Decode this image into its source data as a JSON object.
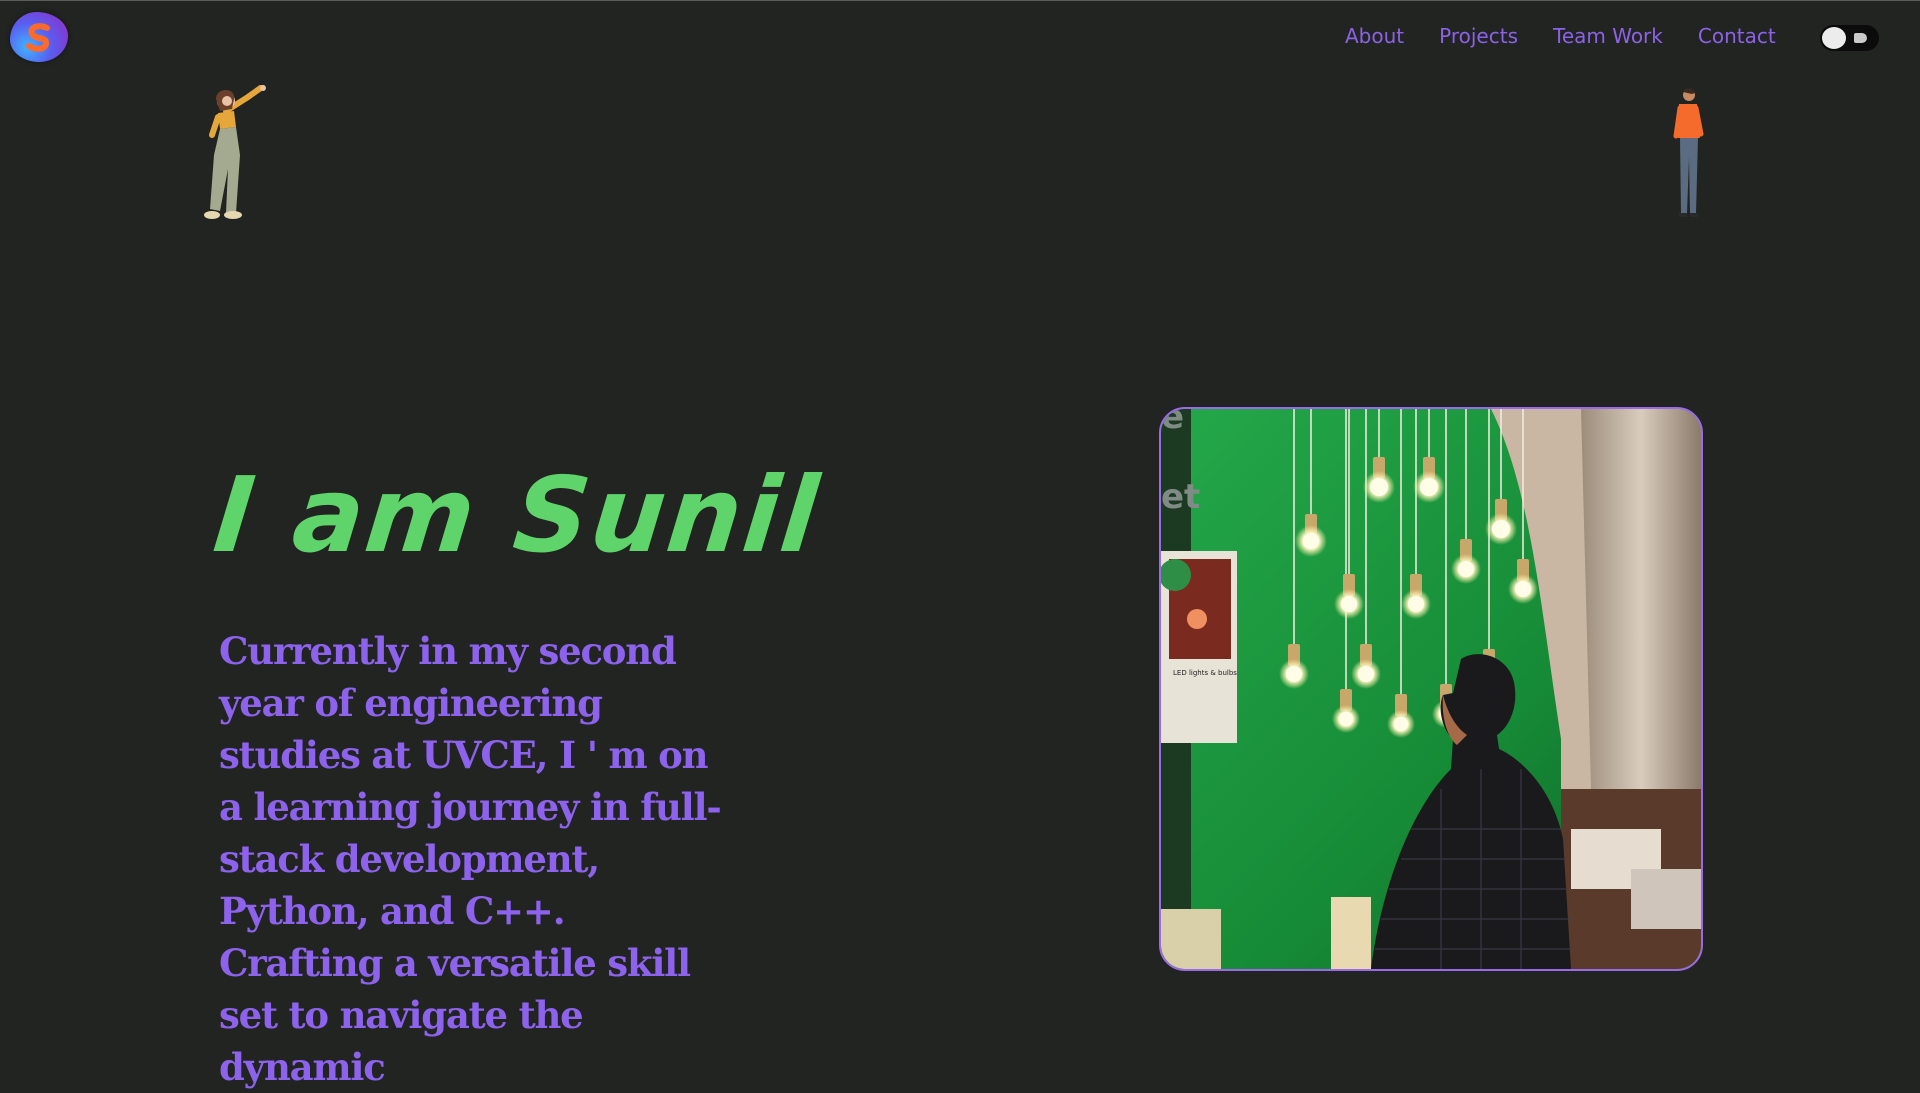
{
  "header": {
    "logo_letter": "S",
    "nav": [
      "About",
      "Projects",
      "Team Work",
      "Contact"
    ],
    "theme_toggle": "light-bulb-toggle"
  },
  "hero": {
    "title": "I am Sunil",
    "description": "Currently in my second year of engineering studies at UVCE, I ' m on a learning journey in full-stack development, Python, and C++. Crafting a versatile skill set to navigate the dynamic"
  },
  "photo": {
    "overlay_fragments": [
      "e",
      "et"
    ],
    "poster_text": "LED lights & bulbs"
  },
  "colors": {
    "background": "#222421",
    "accent_purple": "#8b62e8",
    "accent_green": "#5fd46a"
  }
}
